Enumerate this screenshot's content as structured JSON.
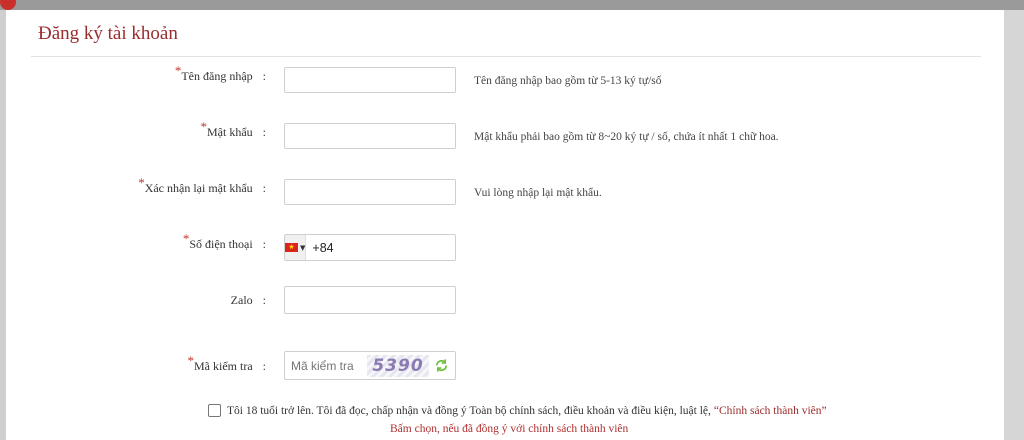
{
  "form": {
    "title": "Đăng ký tài khoản",
    "colon": ":",
    "required_mark": "*",
    "username": {
      "label": "Tên đăng nhập",
      "value": "",
      "hint": "Tên đăng nhập bao gồm từ 5-13 ký tự/số"
    },
    "password": {
      "label": "Mật khẩu",
      "value": "",
      "hint": "Mật khẩu phải bao gồm từ 8~20 ký tự / số, chứa ít nhất 1 chữ hoa."
    },
    "confirm_password": {
      "label": "Xác nhận lại mật khẩu",
      "value": "",
      "hint": "Vui lòng nhập lại mật khẩu."
    },
    "phone": {
      "label": "Số điện thoại",
      "value": "+84",
      "country_flag": "vietnam-flag-icon"
    },
    "zalo": {
      "label": "Zalo",
      "value": ""
    },
    "captcha": {
      "label": "Mã kiểm tra",
      "placeholder": "Mã kiểm tra",
      "code": "5390"
    },
    "agreement": {
      "text": "Tôi 18 tuổi trở lên. Tôi đã đọc, chấp nhận và đồng ý Toàn bộ chính sách, điều khoản và điều kiện, luật lệ,",
      "policy_link": "“Chính sách thành viên”",
      "checked": false
    },
    "notice": "Bấm chọn, nếu đã đồng ý với chính sách thành viên"
  },
  "colors": {
    "accent": "#9b2c2c",
    "required": "#c0392b",
    "refresh": "#6cbf3a"
  }
}
